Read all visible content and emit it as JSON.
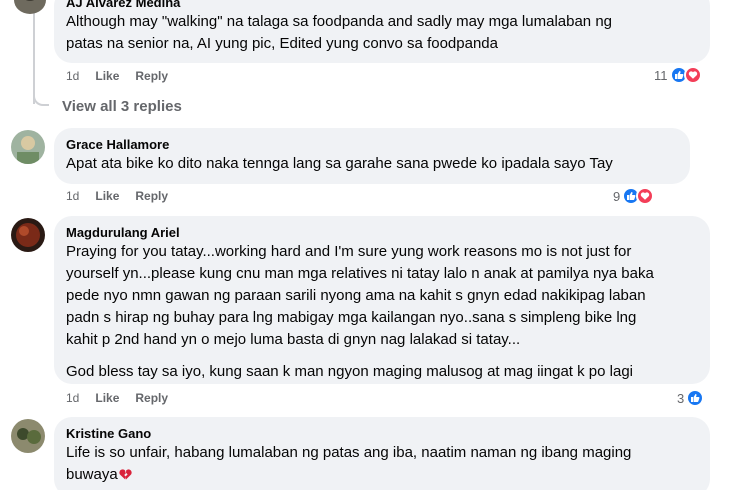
{
  "comments": [
    {
      "author": "AJ Alvarez Medina",
      "paragraphs": [
        "Although may \"walking\" na talaga sa foodpanda and sadly may mga lumalaban ng",
        "patas na senior na, AI yung pic, Edited yung convo sa foodpanda"
      ],
      "time": "1d",
      "like_label": "Like",
      "reply_label": "Reply",
      "reaction_count": "11"
    },
    {
      "author": "Grace Hallamore",
      "paragraphs": [
        "Apat ata bike ko dito naka tennga lang sa garahe sana pwede ko ipadala sayo Tay"
      ],
      "time": "1d",
      "like_label": "Like",
      "reply_label": "Reply",
      "reaction_count": "9"
    },
    {
      "author": "Magdurulang Ariel",
      "lines": [
        "Praying for you tatay...working hard and I'm sure yung work reasons mo is not just for",
        "yourself yn...please kung cnu man mga relatives ni tatay lalo n anak at pamilya nya baka",
        "pede nyo nmn gawan ng paraan sarili nyong ama na kahit s gnyn edad nakikipag laban",
        "padn s hirap ng buhay para lng mabigay mga kailangan nyo..sana s simpleng bike lng",
        "kahit p 2nd hand yn o mejo luma basta di gnyn nag lalakad si tatay..."
      ],
      "closing": "God bless tay sa iyo, kung saan k man ngyon maging malusog at mag iingat k po lagi",
      "time": "1d",
      "like_label": "Like",
      "reply_label": "Reply",
      "reaction_count": "3"
    },
    {
      "author": "Kristine Gano",
      "lines": [
        "Life is so unfair, habang lumalaban ng patas ang iba, naatim naman ng ibang maging",
        "buwaya"
      ],
      "emoji": "broken-heart-icon"
    }
  ],
  "view_replies_label": "View all 3 replies",
  "colors": {
    "like": "#1877f2",
    "love": "#f33e58",
    "bubble": "#f0f2f5",
    "meta": "#65676b"
  }
}
